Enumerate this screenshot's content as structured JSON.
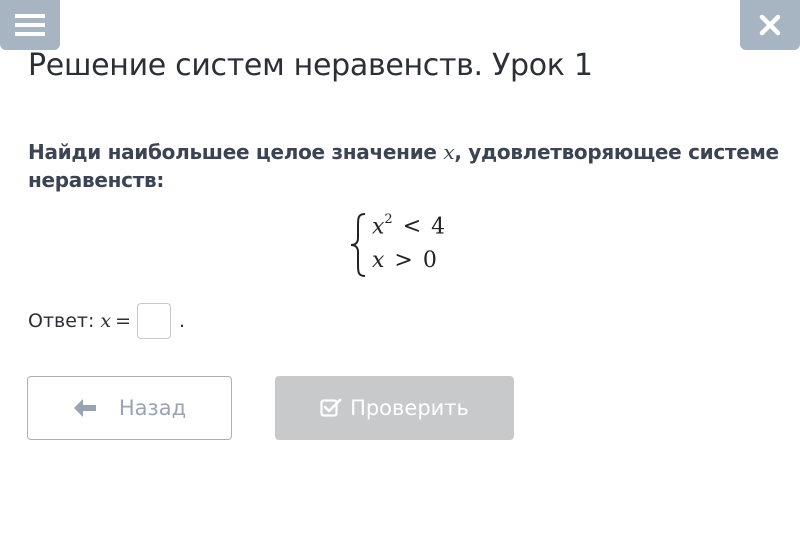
{
  "header": {
    "menu_icon": "hamburger-icon",
    "close_icon": "close-icon",
    "title": "Решение систем неравенств. Урок 1"
  },
  "task": {
    "question_before": "Найди наибольшее целое значение ",
    "question_var": "x",
    "question_after": ", удовлетворяющее системе неравенств:",
    "system": {
      "line1_var": "x",
      "line1_exp": "2",
      "line1_op": "<",
      "line1_rhs": "4",
      "line2_var": "x",
      "line2_op": ">",
      "line2_rhs": "0"
    },
    "answer_label": "Ответ:",
    "answer_var": "x",
    "answer_eq": "=",
    "answer_value": "",
    "answer_end": "."
  },
  "buttons": {
    "back_label": "Назад",
    "back_icon": "arrow-left-icon",
    "check_label": "Проверить",
    "check_icon": "checkbox-icon"
  },
  "colors": {
    "header_button": "#a7b4c2",
    "check_button_disabled": "#c7c9cb",
    "back_button_text": "#98a4b1"
  }
}
